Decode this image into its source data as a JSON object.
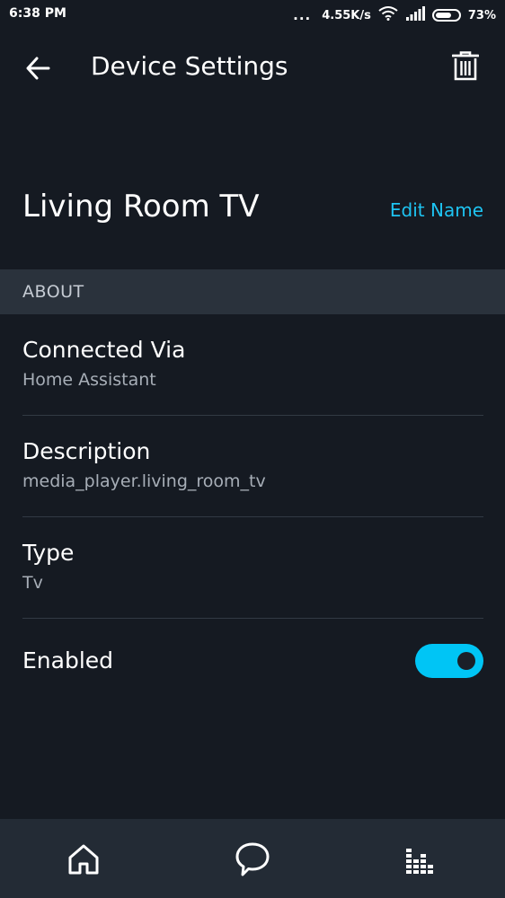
{
  "status_bar": {
    "time": "6:38 PM",
    "more_dots": "...",
    "network_speed": "4.55K/s",
    "battery_percent": "73%",
    "battery_level": 0.73
  },
  "app_bar": {
    "title": "Device Settings",
    "back_icon": "arrow-left-icon",
    "delete_icon": "trash-icon"
  },
  "device": {
    "name": "Living Room TV",
    "edit_label": "Edit Name"
  },
  "about": {
    "header": "ABOUT",
    "rows": [
      {
        "title": "Connected Via",
        "value": "Home Assistant"
      },
      {
        "title": "Description",
        "value": "media_player.living_room_tv"
      },
      {
        "title": "Type",
        "value": "Tv"
      }
    ],
    "enabled_label": "Enabled",
    "enabled": true
  },
  "bottom_nav": {
    "items": [
      {
        "icon": "home-icon"
      },
      {
        "icon": "chat-bubble-icon"
      },
      {
        "icon": "devices-icon"
      }
    ]
  },
  "colors": {
    "background": "#151a22",
    "accent": "#00c5f5",
    "link": "#1ec4f2",
    "section_header": "#2a323c",
    "nav_background": "#232b35"
  }
}
